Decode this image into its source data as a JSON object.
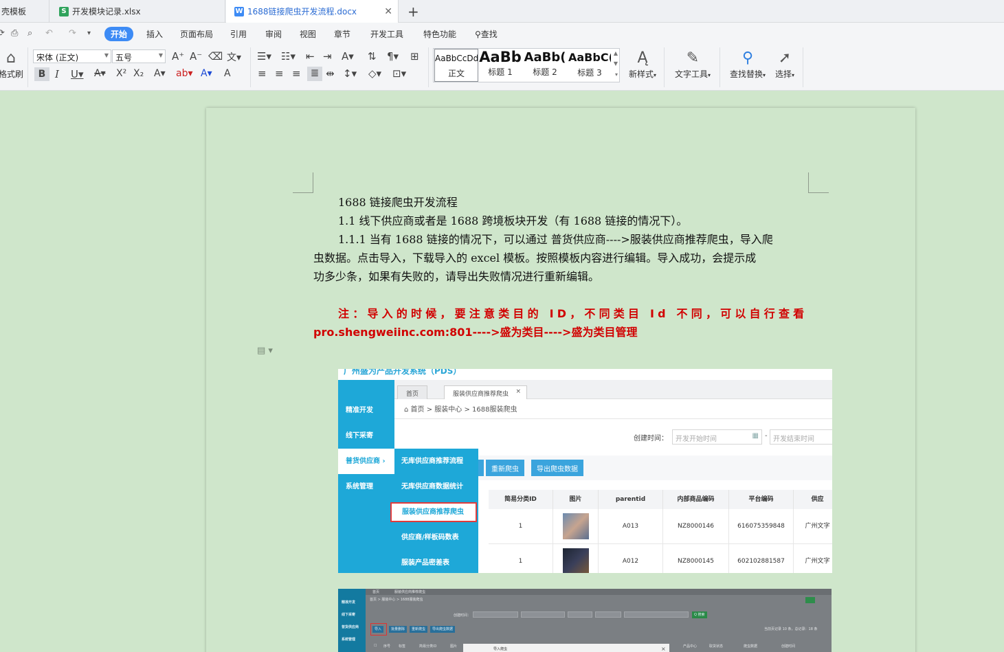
{
  "tabs": [
    {
      "label": "壳模板",
      "icon": "",
      "active": false
    },
    {
      "label": "开发模块记录.xlsx",
      "icon": "S",
      "active": false
    },
    {
      "label": "1688链接爬虫开发流程.docx",
      "icon": "W",
      "active": true
    }
  ],
  "menu": [
    "开始",
    "插入",
    "页面布局",
    "引用",
    "审阅",
    "视图",
    "章节",
    "开发工具",
    "特色功能"
  ],
  "search_label": "查找",
  "ribbon": {
    "format_painter": "格式刷",
    "font_name": "宋体 (正文)",
    "font_size": "五号",
    "styles": [
      {
        "preview": "AaBbCcDd",
        "name": "正文"
      },
      {
        "preview": "AaBb",
        "name": "标题 1"
      },
      {
        "preview": "AaBb(",
        "name": "标题 2"
      },
      {
        "preview": "AaBbC(",
        "name": "标题 3"
      }
    ],
    "new_style": "新样式",
    "text_tools": "文字工具",
    "find_replace": "查找替换",
    "select": "选择"
  },
  "document": {
    "line1": "1688 链接爬虫开发流程",
    "line2": "1.1  线下供应商或者是 1688 跨境板块开发（有 1688 链接的情况下）。",
    "para3_a": "1.1.1 当有 1688 链接的情况下，可以通过  普货供应商---->服装供应商推荐爬虫，导入爬",
    "para3_b": "虫数据。点击导入，下载导入的 excel 模板。按照模板内容进行编辑。导入成功，会提示成",
    "para3_c": "功多少条，如果有失败的，请导出失败情况进行重新编辑。",
    "note_a": "注：导入的时候，要注意类目的 ID，不同类目 Id 不同，可以自行查看",
    "note_b": "pro.shengweiinc.com:801---->盛为类目---->盛为类目管理"
  },
  "shot1": {
    "app_title": "广州盛为产品开发系统（PDS）",
    "sidebar": [
      "精准开发",
      "线下采寄",
      "普货供应商",
      "系统管理"
    ],
    "submenu": [
      "无库供应商推荐流程",
      "无库供应商数据统计",
      "服装供应商推荐爬虫",
      "供应商/样板码数表",
      "服装产品密差表"
    ],
    "tabs": [
      "首页",
      "服装供应商推荐爬虫"
    ],
    "breadcrumb": "首页  >  服装中心 >  1688服装爬虫",
    "created_label": "创建时间：",
    "start_placeholder": "开发开始时间",
    "end_placeholder": "开发结束时间",
    "dash": "-",
    "buttons": [
      "重新爬虫",
      "导出爬虫数据"
    ],
    "columns": [
      "简易分类ID",
      "图片",
      "parentid",
      "内部商品编码",
      "平台编码",
      "供应"
    ],
    "rows": [
      {
        "cat": "1",
        "parent": "A013",
        "code": "NZ8000146",
        "platform": "616075359848",
        "supplier": "广州文字"
      },
      {
        "cat": "1",
        "parent": "A012",
        "code": "NZ8000145",
        "platform": "602102881587",
        "supplier": "广州文字"
      }
    ]
  },
  "shot2": {
    "sidebar": [
      "精准开发",
      "线下采寄",
      "普货供应商",
      "系统管理"
    ],
    "tabs": [
      "首页",
      "服装供应商推荐爬虫"
    ],
    "breadcrumb": "首页 > 服装中心 > 1688服装爬虫",
    "created_label": "创建时间：",
    "buttons": [
      "导入",
      "批量删除",
      "重新爬虫",
      "导出爬虫数据"
    ],
    "query_btn": "Q 搜索",
    "count_text": "当前页记录 10 条，总记录：18 条",
    "columns": [
      "序号",
      "标签",
      "简易分类ID",
      "图片",
      "parentid"
    ],
    "modal_title": "导入爬虫",
    "more_cols": [
      "产品中心",
      "取货状态",
      "爬虫数据",
      "创建时间"
    ]
  },
  "colors": {
    "accent": "#3d8bf5",
    "note_red": "#d10000",
    "sidebar_blue": "#1ea8d8",
    "page_bg": "#cfe6cb"
  }
}
